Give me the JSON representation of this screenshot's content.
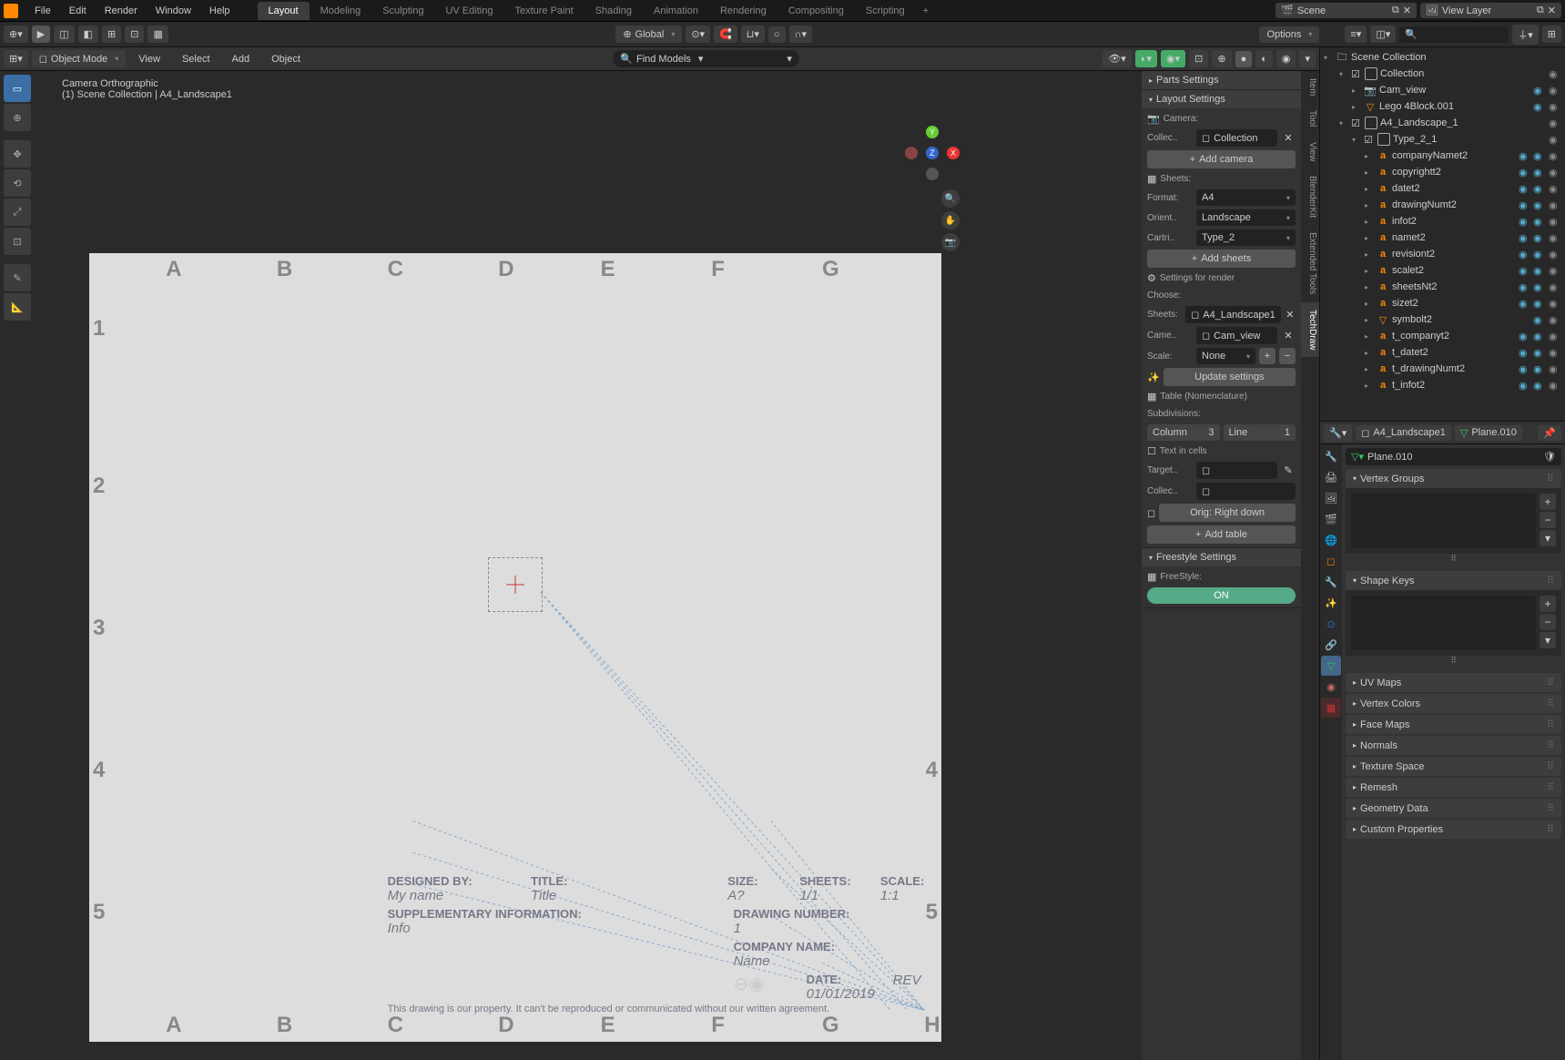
{
  "menu": {
    "file": "File",
    "edit": "Edit",
    "render": "Render",
    "window": "Window",
    "help": "Help"
  },
  "workspaces": [
    "Layout",
    "Modeling",
    "Sculpting",
    "UV Editing",
    "Texture Paint",
    "Shading",
    "Animation",
    "Rendering",
    "Compositing",
    "Scripting"
  ],
  "scene_name": "Scene",
  "view_layer": "View Layer",
  "toolbar": {
    "orientation": "Global",
    "options": "Options"
  },
  "viewport_header": {
    "mode": "Object Mode",
    "view": "View",
    "select": "Select",
    "add": "Add",
    "object": "Object",
    "find": "Find Models"
  },
  "canvas": {
    "title": "Camera Orthographic",
    "subtitle": "(1) Scene Collection | A4_Landscape1",
    "cols": [
      "A",
      "B",
      "C",
      "D",
      "E",
      "F",
      "G",
      "H"
    ],
    "rows": [
      "1",
      "2",
      "3",
      "4",
      "5"
    ]
  },
  "titleblock": {
    "designed_by_l": "DESIGNED BY:",
    "designed_by": "My name",
    "title_l": "TITLE:",
    "title": "Title",
    "size_l": "SIZE:",
    "size": "A?",
    "sheets_l": "SHEETS:",
    "sheets": "1/1",
    "scale_l": "SCALE:",
    "scale": "1:1",
    "info_l": "SUPPLEMENTARY INFORMATION:",
    "info": "Info",
    "dwg_l": "DRAWING NUMBER:",
    "dwg": "1",
    "company_l": "COMPANY NAME:",
    "company": "Name",
    "date_l": "DATE:",
    "date": "01/01/2019",
    "rev": "REV",
    "copyright": "This drawing is our property. It can't be reproduced or communicated without our written agreement."
  },
  "n_panel": {
    "tabs": [
      "Item",
      "Tool",
      "View",
      "BlenderKit",
      "Extended Tools",
      "TechDraw"
    ],
    "parts_settings": "Parts Settings",
    "layout_settings": "Layout Settings",
    "camera_l": "Camera:",
    "collec_l": "Collec..",
    "collec_v": "Collection",
    "add_camera": "Add camera",
    "sheets_l": "Sheets:",
    "format_l": "Format:",
    "format_v": "A4",
    "orient_l": "Orient..",
    "orient_v": "Landscape",
    "cartri_l": "Cartri..",
    "cartri_v": "Type_2",
    "add_sheets": "Add sheets",
    "settings_render": "Settings for render",
    "choose": "Choose:",
    "sheets2_l": "Sheets:",
    "sheets2_v": "A4_Landscape1",
    "came_l": "Came..",
    "came_v": "Cam_view",
    "scale_l": "Scale:",
    "scale_v": "None",
    "update": "Update settings",
    "table_l": "Table (Nomenclature)",
    "subdiv": "Subdivisions:",
    "column_l": "Column",
    "column_v": "3",
    "line_l": "Line",
    "line_v": "1",
    "text_cells": "Text in cells",
    "target_l": "Target..",
    "collec2_l": "Collec..",
    "orig": "Orig: Right down",
    "add_table": "Add table",
    "freestyle_settings": "Freestyle Settings",
    "freestyle_l": "FreeStyle:",
    "on": "ON"
  },
  "outliner": {
    "root": "Scene Collection",
    "items": [
      {
        "label": "Collection",
        "type": "coll",
        "depth": 1,
        "expanded": true
      },
      {
        "label": "Cam_view",
        "type": "cam",
        "depth": 2
      },
      {
        "label": "Lego 4Block.001",
        "type": "mesh",
        "depth": 2
      },
      {
        "label": "A4_Landscape_1",
        "type": "coll",
        "depth": 1,
        "expanded": true
      },
      {
        "label": "Type_2_1",
        "type": "coll",
        "depth": 2,
        "expanded": true
      },
      {
        "label": "companyNamet2",
        "type": "text",
        "depth": 3
      },
      {
        "label": "copyrightt2",
        "type": "text",
        "depth": 3
      },
      {
        "label": "datet2",
        "type": "text",
        "depth": 3
      },
      {
        "label": "drawingNumt2",
        "type": "text",
        "depth": 3
      },
      {
        "label": "infot2",
        "type": "text",
        "depth": 3
      },
      {
        "label": "namet2",
        "type": "text",
        "depth": 3
      },
      {
        "label": "revisiont2",
        "type": "text",
        "depth": 3
      },
      {
        "label": "scalet2",
        "type": "text",
        "depth": 3
      },
      {
        "label": "sheetsNt2",
        "type": "text",
        "depth": 3
      },
      {
        "label": "sizet2",
        "type": "text",
        "depth": 3
      },
      {
        "label": "symbolt2",
        "type": "mesh",
        "depth": 3
      },
      {
        "label": "t_companyt2",
        "type": "text",
        "depth": 3
      },
      {
        "label": "t_datet2",
        "type": "text",
        "depth": 3
      },
      {
        "label": "t_drawingNumt2",
        "type": "text",
        "depth": 3
      },
      {
        "label": "t_infot2",
        "type": "text",
        "depth": 3
      }
    ]
  },
  "props": {
    "breadcrumb1": "A4_Landscape1",
    "breadcrumb2": "Plane.010",
    "name": "Plane.010",
    "panels": [
      "Vertex Groups",
      "Shape Keys",
      "UV Maps",
      "Vertex Colors",
      "Face Maps",
      "Normals",
      "Texture Space",
      "Remesh",
      "Geometry Data",
      "Custom Properties"
    ]
  }
}
